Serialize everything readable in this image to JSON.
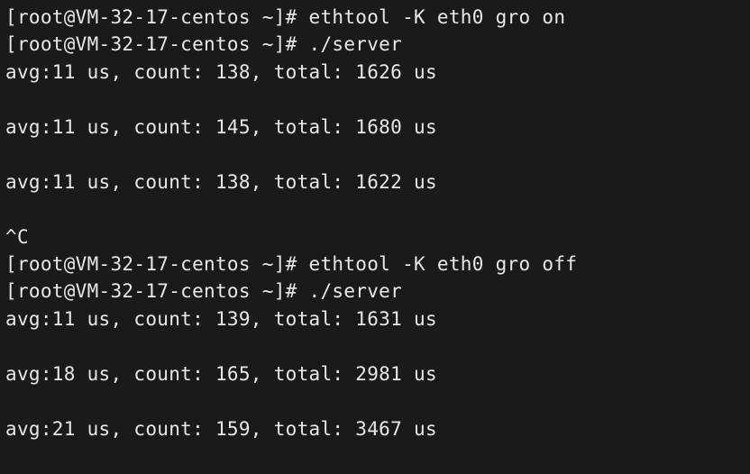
{
  "lines": {
    "l0": "[root@VM-32-17-centos ~]# ethtool -K eth0 gro on",
    "l1": "[root@VM-32-17-centos ~]# ./server",
    "l2": "avg:11 us, count: 138, total: 1626 us",
    "l3": "avg:11 us, count: 145, total: 1680 us",
    "l4": "avg:11 us, count: 138, total: 1622 us",
    "l5": "^C",
    "l6": "[root@VM-32-17-centos ~]# ethtool -K eth0 gro off",
    "l7": "[root@VM-32-17-centos ~]# ./server",
    "l8": "avg:11 us, count: 139, total: 1631 us",
    "l9": "avg:18 us, count: 165, total: 2981 us",
    "l10": "avg:21 us, count: 159, total: 3467 us"
  }
}
